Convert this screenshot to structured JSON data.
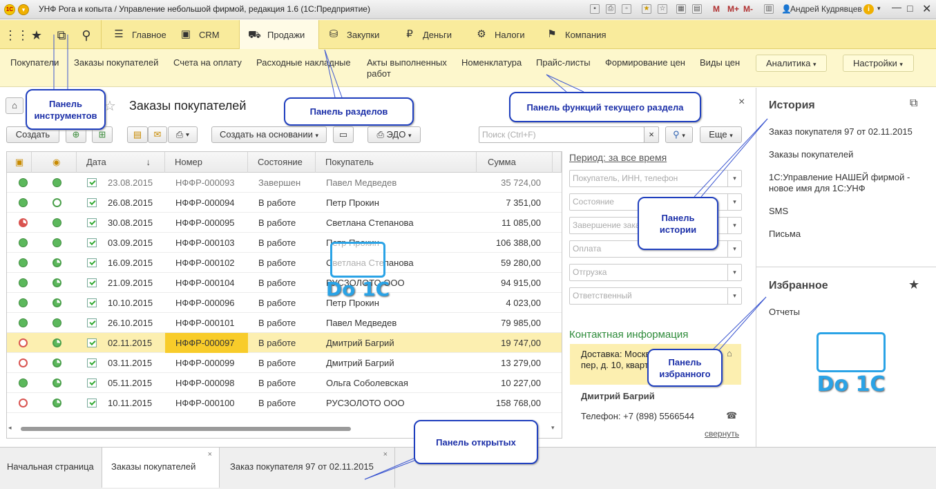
{
  "window": {
    "title": "УНФ Рога и копыта / Управление небольшой фирмой, редакция 1.6  (1С:Предприятие)",
    "user": "Андрей Кудрявцев",
    "m": "M",
    "mplus": "M+",
    "mminus": "M-"
  },
  "sections": [
    {
      "label": "Главное",
      "icon": "menu-lines-icon"
    },
    {
      "label": "CRM",
      "icon": "crm-icon"
    },
    {
      "label": "Продажи",
      "icon": "basket-icon",
      "active": true
    },
    {
      "label": "Закупки",
      "icon": "cart-icon"
    },
    {
      "label": "Деньги",
      "icon": "coin-icon"
    },
    {
      "label": "Налоги",
      "icon": "taxes-icon"
    },
    {
      "label": "Компания",
      "icon": "flag-icon"
    }
  ],
  "functions": [
    "Покупатели",
    "Заказы покупателей",
    "Счета на оплату",
    "Расходные накладные",
    "Акты выполненных работ",
    "Номенклатура",
    "Прайс-листы",
    "Формирование цен",
    "Виды цен"
  ],
  "func_buttons": {
    "analytics": "Аналитика",
    "settings": "Настройки"
  },
  "form": {
    "title": "Заказы покупателей",
    "create": "Создать",
    "create_based": "Создать на основании",
    "edo": "ЭДО",
    "search_placeholder": "Поиск (Ctrl+F)",
    "more": "Еще",
    "close": "×"
  },
  "table": {
    "columns": [
      "Дата",
      "Номер",
      "Состояние",
      "Покупатель",
      "Сумма"
    ],
    "sort_arrow": "↓",
    "rows": [
      {
        "date": "23.08.2015",
        "num": "НФФР-000093",
        "state": "Завершен",
        "buyer": "Павел Медведев",
        "sum": "35 724,00",
        "s1": "g",
        "s2": "g",
        "gray": true
      },
      {
        "date": "26.08.2015",
        "num": "НФФР-000094",
        "state": "В работе",
        "buyer": "Петр Прокин",
        "sum": "7 351,00",
        "s1": "g",
        "s2": "go"
      },
      {
        "date": "30.08.2015",
        "num": "НФФР-000095",
        "state": "В работе",
        "buyer": "Светлана Степанова",
        "sum": "11 085,00",
        "s1": "rc",
        "s2": "g"
      },
      {
        "date": "03.09.2015",
        "num": "НФФР-000103",
        "state": "В работе",
        "buyer": "Петр Прокин",
        "sum": "106 388,00",
        "s1": "g",
        "s2": "g"
      },
      {
        "date": "16.09.2015",
        "num": "НФФР-000102",
        "state": "В работе",
        "buyer": "Светлана Степанова",
        "sum": "59 280,00",
        "s1": "g",
        "s2": "gc"
      },
      {
        "date": "21.09.2015",
        "num": "НФФР-000104",
        "state": "В работе",
        "buyer": "РУСЗОЛОТО ООО",
        "sum": "94 915,00",
        "s1": "g",
        "s2": "gc"
      },
      {
        "date": "10.10.2015",
        "num": "НФФР-000096",
        "state": "В работе",
        "buyer": "Петр Прокин",
        "sum": "4 023,00",
        "s1": "g",
        "s2": "gc"
      },
      {
        "date": "26.10.2015",
        "num": "НФФР-000101",
        "state": "В работе",
        "buyer": "Павел Медведев",
        "sum": "79 985,00",
        "s1": "g",
        "s2": "g"
      },
      {
        "date": "02.11.2015",
        "num": "НФФР-000097",
        "state": "В работе",
        "buyer": "Дмитрий Багрий",
        "sum": "19 747,00",
        "s1": "ro",
        "s2": "gc",
        "selected": true
      },
      {
        "date": "03.11.2015",
        "num": "НФФР-000099",
        "state": "В работе",
        "buyer": "Дмитрий Багрий",
        "sum": "13 279,00",
        "s1": "ro",
        "s2": "gc"
      },
      {
        "date": "05.11.2015",
        "num": "НФФР-000098",
        "state": "В работе",
        "buyer": "Ольга Соболевская",
        "sum": "10 227,00",
        "s1": "g",
        "s2": "gc"
      },
      {
        "date": "10.11.2015",
        "num": "НФФР-000100",
        "state": "В работе",
        "buyer": "РУСЗОЛОТО ООО",
        "sum": "158 768,00",
        "s1": "ro",
        "s2": "gc"
      }
    ]
  },
  "filters": {
    "period": "Период: за все время",
    "fields": [
      "Покупатель, ИНН, телефон",
      "Состояние",
      "Завершение заказа",
      "Оплата",
      "Отгрузка",
      "Ответственный"
    ]
  },
  "contact": {
    "title": "Контактная информация",
    "delivery": "Доставка: Москва, Пушкарев пер, д. 10, квартира 41",
    "name": "Дмитрий Багрий",
    "phone": "Телефон: +7 (898) 5566544",
    "collapse": "свернуть"
  },
  "history": {
    "title": "История",
    "items": [
      "Заказ покупателя 97 от 02.11.2015",
      "Заказы покупателей",
      "1С:Управление НАШЕЙ фирмой - новое имя для 1С:УНФ",
      "SMS",
      "Письма"
    ]
  },
  "favorites": {
    "title": "Избранное",
    "items": [
      "Отчеты"
    ]
  },
  "tabs": [
    "Начальная страница",
    "Заказы покупателей",
    "Заказ покупателя 97 от 02.11.2015"
  ],
  "callouts": {
    "tools": "Панель инструментов",
    "sections": "Панель разделов",
    "functions": "Панель функций текущего раздела",
    "history": "Панель истории",
    "favorites": "Панель избранного",
    "open": "Панель открытых"
  },
  "watermark": "Do 1C"
}
